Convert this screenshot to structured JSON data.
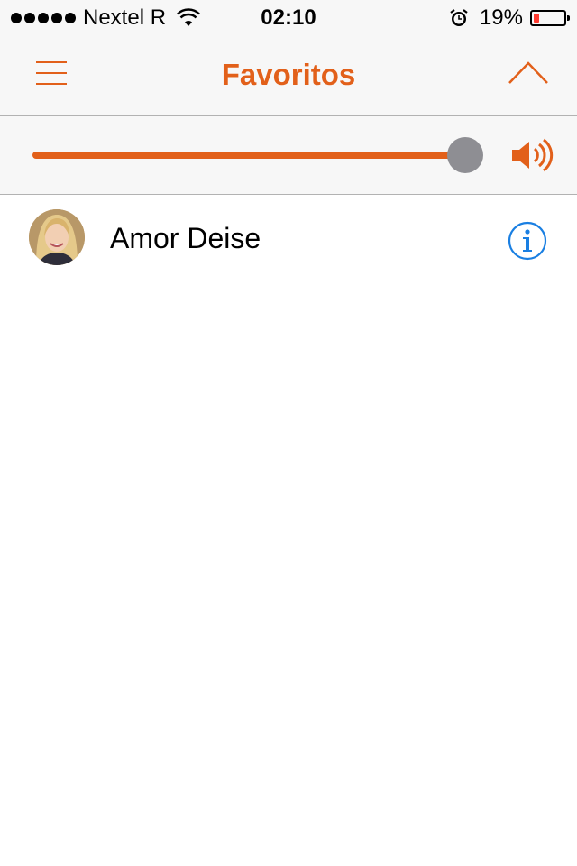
{
  "status_bar": {
    "carrier": "Nextel R",
    "time": "02:10",
    "battery_percent": "19%",
    "battery_level": 0.19,
    "icons": [
      "signal-dots-icon",
      "wifi-icon",
      "alarm-icon",
      "battery-icon"
    ]
  },
  "nav": {
    "title": "Favoritos",
    "left_icon": "menu-icon",
    "right_icon": "chevron-up-icon"
  },
  "volume": {
    "level": 1.0,
    "icon": "speaker-icon"
  },
  "favorites": [
    {
      "name": "Amor Deise",
      "avatar_icon": "avatar-photo",
      "accessory_icon": "info-icon"
    }
  ],
  "colors": {
    "accent": "#e2601a",
    "info_blue": "#1a7fe2",
    "thumb_gray": "#8e8e93",
    "bar_bg": "#f7f7f7",
    "battery_low": "#ff3b30"
  }
}
